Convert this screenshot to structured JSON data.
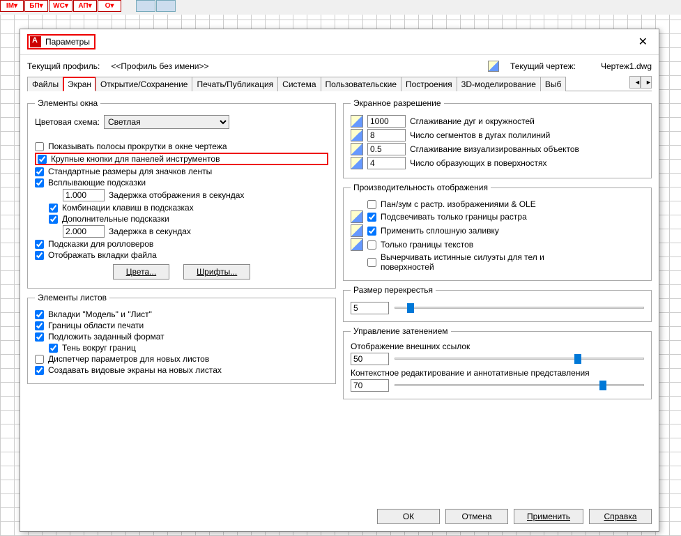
{
  "title": "Параметры",
  "profile_label": "Текущий профиль:",
  "profile_value": "<<Профиль без имени>>",
  "drawing_label": "Текущий чертеж:",
  "drawing_value": "Чертеж1.dwg",
  "tabs": [
    "Файлы",
    "Экран",
    "Открытие/Сохранение",
    "Печать/Публикация",
    "Система",
    "Пользовательские",
    "Построения",
    "3D-моделирование",
    "Выб"
  ],
  "win_elems": {
    "legend": "Элементы окна",
    "scheme_label": "Цветовая схема:",
    "scheme_value": "Светлая",
    "scrollbars": "Показывать полосы прокрутки в окне чертежа",
    "large_buttons": "Крупные кнопки для панелей инструментов",
    "std_sizes": "Стандартные размеры для значков ленты",
    "tooltips": "Всплывающие подсказки",
    "delay1_val": "1.000",
    "delay1_lbl": "Задержка отображения в секундах",
    "shortcuts": "Комбинации клавиш в подсказках",
    "ext_tips": "Дополнительные подсказки",
    "delay2_val": "2.000",
    "delay2_lbl": "Задержка в секундах",
    "rollover": "Подсказки для ролловеров",
    "file_tabs": "Отображать вкладки файла",
    "colors_btn": "Цвета...",
    "fonts_btn": "Шрифты..."
  },
  "sheet_elems": {
    "legend": "Элементы листов",
    "model_tabs": "Вкладки \"Модель\" и \"Лист\"",
    "print_bounds": "Границы области печати",
    "paper_format": "Подложить заданный формат",
    "shadow": "Тень вокруг границ",
    "dispatcher": "Диспетчер параметров для новых листов",
    "viewports": "Создавать видовые экраны на новых листах"
  },
  "resolution": {
    "legend": "Экранное разрешение",
    "v1": "1000",
    "l1": "Сглаживание дуг и окружностей",
    "v2": "8",
    "l2": "Число сегментов в дугах полилиний",
    "v3": "0.5",
    "l3": "Сглаживание визуализированных объектов",
    "v4": "4",
    "l4": "Число образующих в поверхностях"
  },
  "perf": {
    "legend": "Производительность отображения",
    "panzoom": "Пан/зум с растр. изображениями & OLE",
    "raster_bounds": "Подсвечивать только границы растра",
    "solid_fill": "Применить сплошную заливку",
    "text_bounds": "Только границы текстов",
    "silhouettes": "Вычерчивать истинные силуэты для тел и поверхностей"
  },
  "crosshair": {
    "legend": "Размер перекрестья",
    "val": "5"
  },
  "fade": {
    "legend": "Управление затенением",
    "xref_label": "Отображение внешних ссылок",
    "xref_val": "50",
    "edit_label": "Контекстное редактирование и аннотативные представления",
    "edit_val": "70"
  },
  "buttons": {
    "ok": "ОК",
    "cancel": "Отмена",
    "apply": "Применить",
    "help": "Справка"
  }
}
